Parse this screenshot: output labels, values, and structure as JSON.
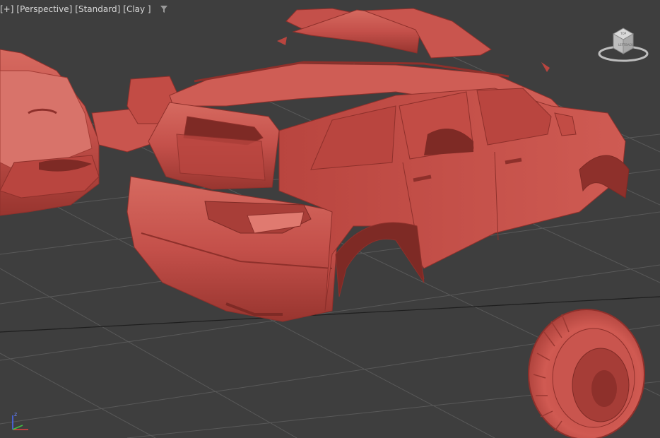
{
  "viewport": {
    "menu_plus": "[+]",
    "view_mode": "[Perspective]",
    "shading_mode": "[Standard]",
    "render_style": "[Clay ]",
    "filter_icon": "funnel-icon"
  },
  "viewcube": {
    "top_face": "TOP",
    "front_face": "BACK",
    "side_face": "LEFT"
  },
  "axis_gizmo": {
    "z": "z",
    "x": "x",
    "y": "y"
  },
  "colors": {
    "background": "#3f3f3f",
    "grid": "#5a5a5a",
    "clay": "#c8514a",
    "clay_dark": "#8e302b",
    "clay_light": "#e07a70"
  }
}
